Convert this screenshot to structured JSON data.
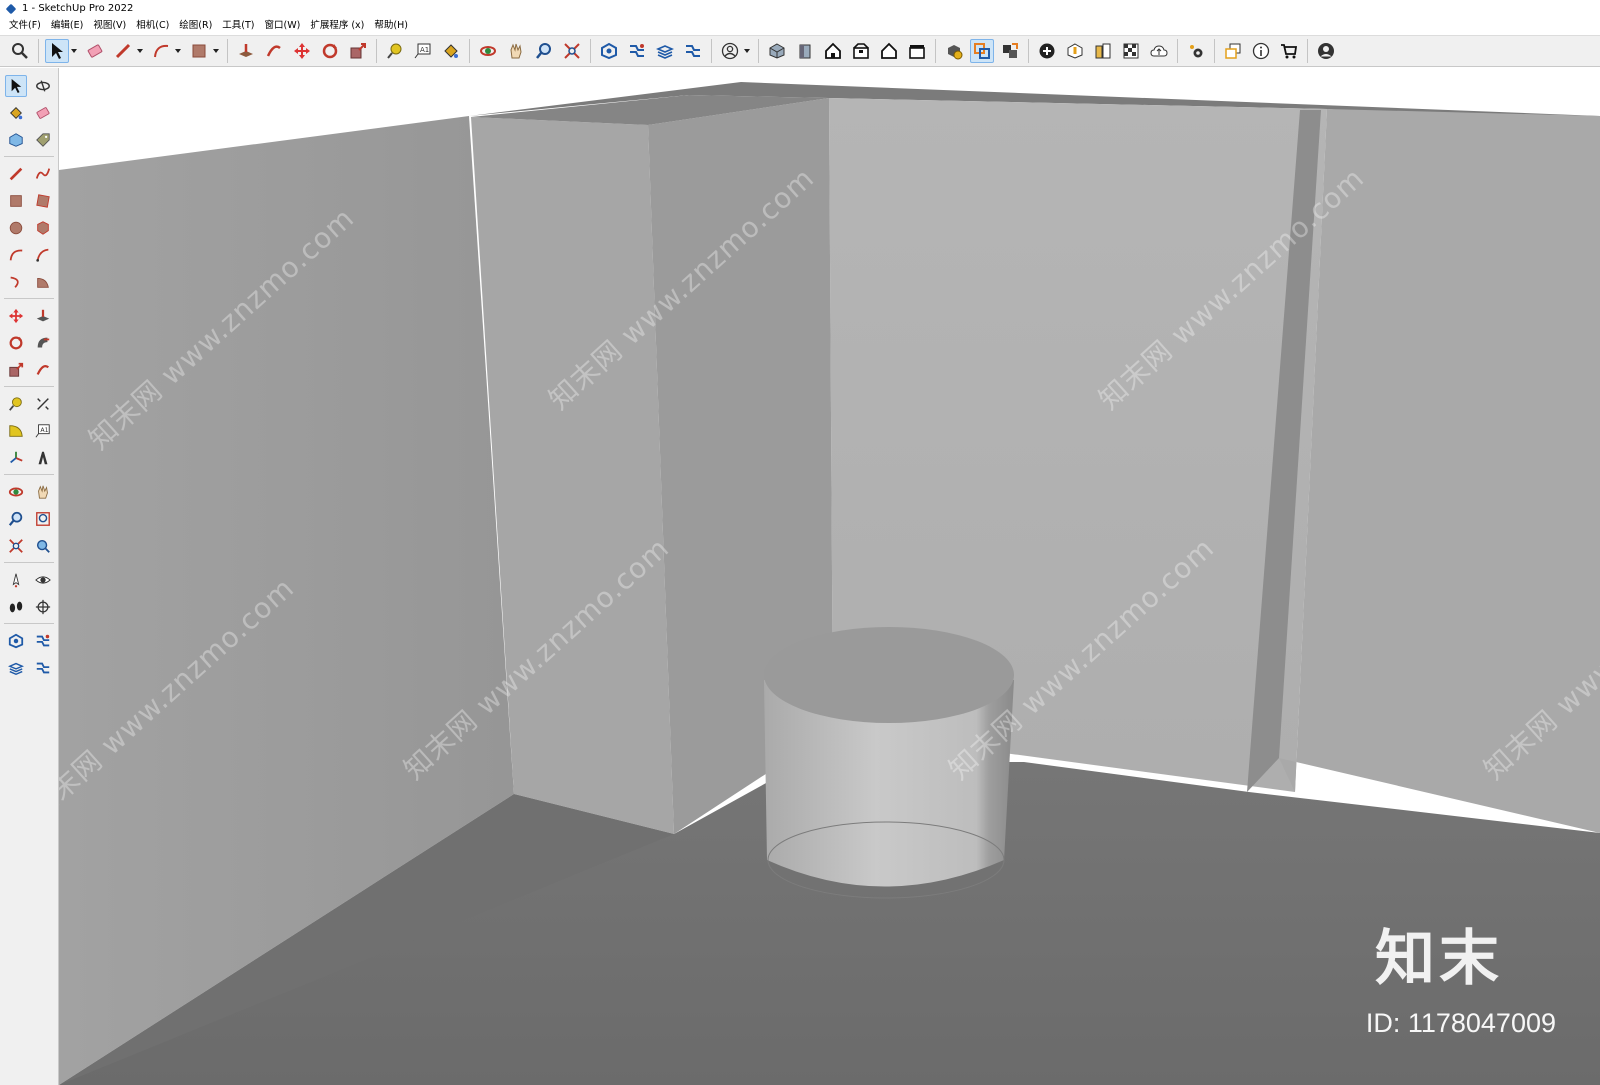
{
  "window": {
    "title": "1 - SketchUp Pro 2022"
  },
  "menu": [
    "文件(F)",
    "编辑(E)",
    "视图(V)",
    "相机(C)",
    "绘图(R)",
    "工具(T)",
    "窗口(W)",
    "扩展程序 (x)",
    "帮助(H)"
  ],
  "watermark": {
    "text": "知末网 www.znzmo.com",
    "brand": "知末",
    "id": "ID: 1178047009"
  },
  "colors": {
    "accent": "#cde4f7",
    "wall_left": "#9c9c9c",
    "wall_back": "#b1b1b1",
    "wall_right": "#a7a7a7",
    "floor": "#6f6f6f",
    "ceiling_edge": "#7a7a7a"
  },
  "toolbar_icons": [
    "zoom-window-icon",
    "select-icon",
    "eraser-icon",
    "pencil-line-icon",
    "arc-icon",
    "rectangle-icon",
    "push-pull-icon",
    "offset-icon",
    "move-icon",
    "rotate-icon",
    "scale-icon",
    "tape-measure-icon",
    "text-icon",
    "paint-bucket-icon",
    "orbit-icon",
    "pan-icon",
    "zoom-icon",
    "zoom-extents-icon",
    "warehouse-icon",
    "extension-warehouse-icon",
    "layout-icon",
    "styles-icon",
    "account-icon",
    "iso-view-icon",
    "front-view-icon",
    "top-view-icon",
    "right-view-icon",
    "back-view-icon",
    "left-view-icon",
    "solid-inspector-icon",
    "outer-shell-icon",
    "intersect-icon",
    "add-location-icon",
    "sandbox-icon",
    "shadow-icon",
    "xray-icon",
    "cloud-icon",
    "extension-manager-icon",
    "section-icon",
    "info-icon",
    "cart-icon",
    "profile-icon"
  ],
  "palette_icons": [
    [
      "select-icon",
      "orbit-icon"
    ],
    [
      "paint-bucket-icon",
      "eraser-icon"
    ],
    [
      "component-icon",
      "tag-icon"
    ],
    [
      "line-icon",
      "freehand-icon"
    ],
    [
      "rectangle-icon",
      "rotated-rectangle-icon"
    ],
    [
      "circle-icon",
      "polygon-icon"
    ],
    [
      "arc-icon",
      "two-point-arc-icon"
    ],
    [
      "three-point-arc-icon",
      "pie-icon"
    ],
    [
      "move-icon",
      "push-pull-icon"
    ],
    [
      "rotate-icon",
      "follow-me-icon"
    ],
    [
      "scale-icon",
      "offset-icon"
    ],
    [
      "tape-measure-icon",
      "dimension-icon"
    ],
    [
      "protractor-icon",
      "text-icon"
    ],
    [
      "axes-icon",
      "3d-text-icon"
    ],
    [
      "orbit-icon",
      "pan-icon"
    ],
    [
      "zoom-icon",
      "zoom-window-icon"
    ],
    [
      "zoom-extents-icon",
      "previous-view-icon"
    ],
    [
      "position-camera-icon",
      "look-around-icon"
    ],
    [
      "walk-icon",
      "section-plane-icon"
    ],
    [
      "warehouse-icon",
      "extension-warehouse-icon"
    ],
    [
      "layout-icon",
      "extension-manager-icon"
    ]
  ]
}
